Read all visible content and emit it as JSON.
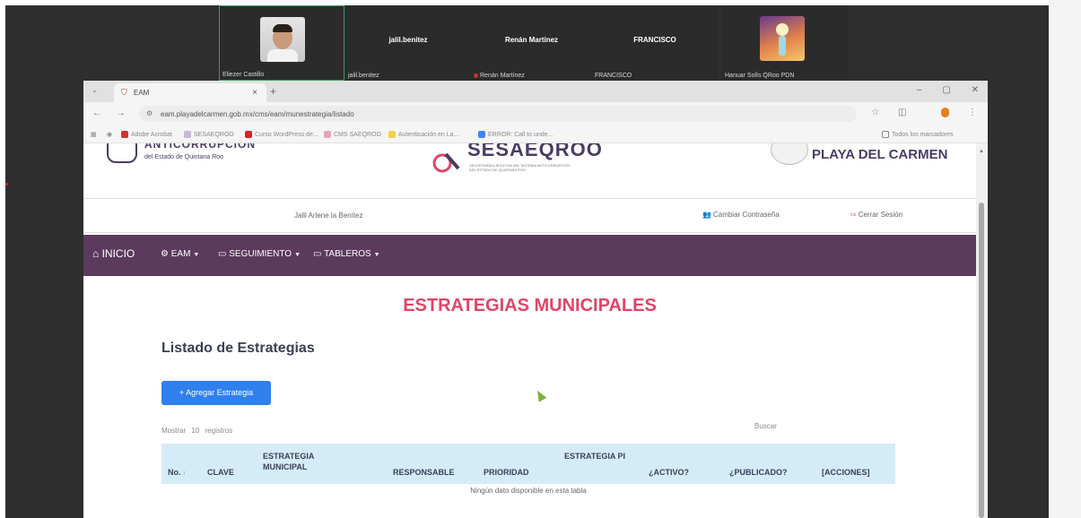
{
  "call": {
    "participants": [
      {
        "tile_label": "Eliezer Castillo",
        "center_name": ""
      },
      {
        "tile_label": "jalil.benitez",
        "center_name": "jalil.benitez"
      },
      {
        "tile_label": "Renán Martínez",
        "center_name": "Renán Martínez"
      },
      {
        "tile_label": "FRANCISCO",
        "center_name": "FRANCISCO"
      },
      {
        "tile_label": "Hanuar Solís QRoo PDN",
        "center_name": ""
      }
    ],
    "active_speaker_color": "#3a9b5c"
  },
  "browser": {
    "tab_title": "EAM",
    "tab_close": "×",
    "new_tab": "+",
    "url": "eam.playadelcarmen.gob.mx/cms/eam/munestrategia/listado",
    "bookmarks": [
      "Adobe Acrobat",
      "SESAEQROO",
      "Curso WordPress de...",
      "CMS SAEQROO",
      "Autenticación en La...",
      "ERROR: Call to unde...",
      "Todos los marcadores"
    ]
  },
  "header": {
    "left_logo_title": "ANTICORRUPCIÓN",
    "left_logo_sub": "del Estado de Quintana Roo",
    "center_logo_title": "SESAEQROO",
    "center_logo_sub": "SECRETARÍA EJECUTIVA DEL SISTEMA ANTICORRUPCIÓN DEL ESTADO DE QUINTANA ROO",
    "right_logo_title": "PLAYA DEL CARMEN"
  },
  "userbar": {
    "user_name": "Jalil Arlene la Benítez",
    "change_password": "Cambiar Contraseña",
    "logout": "Cerrar Sesión"
  },
  "nav": {
    "home": "INICIO",
    "eam": "EAM",
    "seguimiento": "SEGUIMIENTO",
    "tableros": "TABLEROS"
  },
  "content": {
    "main_title": "ESTRATEGIAS MUNICIPALES",
    "subtitle": "Listado de Estrategias",
    "add_button": "+ Agregar Estrategia",
    "show_label": "Mostrar",
    "show_value": "10",
    "records_label": "registros",
    "search_label": "Buscar",
    "columns": [
      "No.",
      "CLAVE",
      "ESTRATEGIA MUNICIPAL",
      "RESPONSABLE",
      "PRIORIDAD",
      "ESTRATEGIA PI",
      "¿ACTIVO?",
      "¿PUBLICADO?",
      "[ACCIONES]"
    ],
    "empty_message": "Ningún dato disponible en esta tabla"
  },
  "colors": {
    "navbar": "#5c3a5e",
    "title": "#e04567",
    "button": "#2f80ed",
    "table_header": "#d4ecf7"
  }
}
